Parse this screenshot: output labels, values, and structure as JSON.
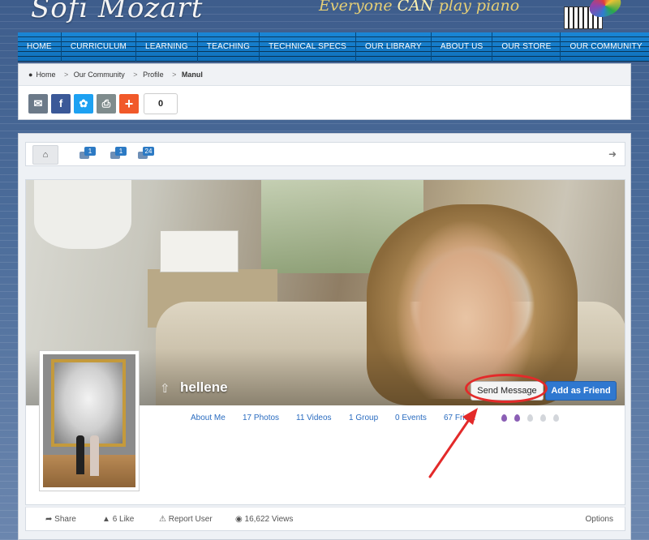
{
  "header": {
    "logo": "Sofi Mozart",
    "tagline_prefix": "Everyone",
    "tagline_can": "CAN",
    "tagline_suffix": "play piano"
  },
  "nav": [
    "HOME",
    "CURRICULUM",
    "LEARNING",
    "TEACHING",
    "TECHNICAL SPECS",
    "OUR LIBRARY",
    "ABOUT US",
    "OUR STORE",
    "OUR COMMUNITY"
  ],
  "breadcrumb": {
    "home": "Home",
    "community": "Our Community",
    "profile": "Profile",
    "current": "Manul",
    "separator": ">"
  },
  "share": {
    "count": "0"
  },
  "toolbar": {
    "badge1": "1",
    "badge2": "1",
    "badge3": "24"
  },
  "profile": {
    "name": "hellene",
    "send_message": "Send Message",
    "add_friend": "Add as Friend",
    "stats": {
      "about": "About Me",
      "photos": "17 Photos",
      "videos": "11 Videos",
      "group": "1 Group",
      "events": "0 Events",
      "friends": "67 Frie..."
    },
    "rating_filled": 2,
    "rating_total": 5
  },
  "footer": {
    "share": "Share",
    "like": "6 Like",
    "report": "Report User",
    "views": "16,622 Views",
    "options": "Options"
  },
  "colors": {
    "accent_blue": "#2f78d0",
    "annotation_red": "#e32a2a",
    "rating_purple": "#8b5fb5"
  }
}
